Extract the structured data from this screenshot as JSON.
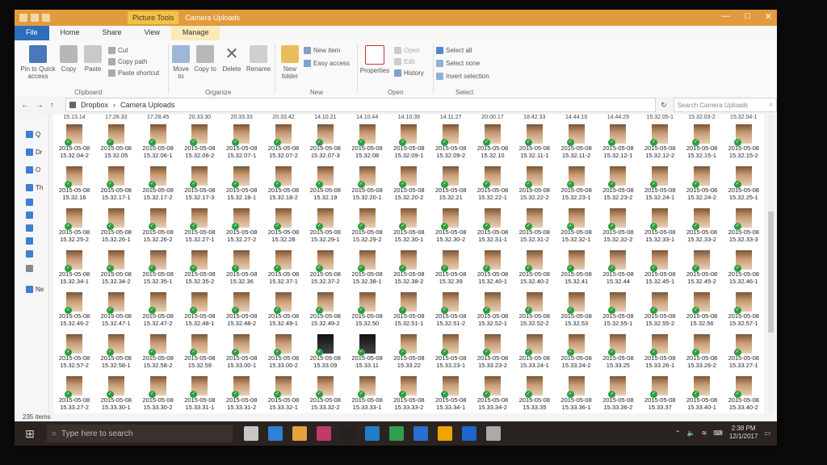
{
  "window": {
    "context_tab": "Picture Tools",
    "title": "Camera Uploads",
    "controls": [
      "—",
      "□",
      "✕"
    ]
  },
  "ribbon_tabs": [
    "File",
    "Home",
    "Share",
    "View",
    "Manage"
  ],
  "ribbon": {
    "pin_quick_access": "Pin to Quick access",
    "copy": "Copy",
    "paste": "Paste",
    "cut": "Cut",
    "copy_path": "Copy path",
    "paste_shortcut": "Paste shortcut",
    "move_to": "Move to",
    "copy_to": "Copy to",
    "delete": "Delete",
    "rename": "Rename",
    "new_folder": "New folder",
    "new_item": "New item",
    "easy_access": "Easy access",
    "properties": "Properties",
    "open": "Open",
    "edit": "Edit",
    "history": "History",
    "select_all": "Select all",
    "select_none": "Select none",
    "invert_selection": "Invert selection",
    "groups": {
      "clipboard": "Clipboard",
      "organize": "Organize",
      "new": "New",
      "open": "Open",
      "select": "Select"
    }
  },
  "address": {
    "path": [
      "Dropbox",
      "Camera Uploads"
    ],
    "search_placeholder": "Search Camera Uploads"
  },
  "nav_items": [
    "Q",
    "Dr",
    "O",
    "Th",
    "",
    "",
    "",
    "",
    "",
    "Ne"
  ],
  "top_times": [
    "15.13.14",
    "17.28.33",
    "17.28.45",
    "20.33.30",
    "20.33.33",
    "20.33.42",
    "14.10.21",
    "14.10.44",
    "14.10.39",
    "14.11.27",
    "20.00.17",
    "18.42.33",
    "14.44.10",
    "14.44.29",
    "15.32.05-1",
    "15.32.03-2",
    "15.32.04-1"
  ],
  "files": [
    [
      "2015-05-08 15.32.04-2",
      "2015-05-08 15.32.05",
      "2015-05-08 15.32.06-1",
      "2015-05-08 15.32.06-2",
      "2015-05-08 15.32.07-1",
      "2015-05-08 15.32.07-2",
      "2015-05-08 15.32.07-3",
      "2015-05-08 15.32.08",
      "2015-05-08 15.32.09-1",
      "2015-05-08 15.32.09-2",
      "2015-05-08 15.32.10",
      "2015-05-08 15.32.11-1",
      "2015-05-08 15.32.11-2",
      "2015-05-08 15.32.12-1",
      "2015-05-08 15.32.12-2",
      "2015-05-08 15.32.15-1",
      "2015-05-08 15.32.15-2"
    ],
    [
      "2015-05-08 15.32.16",
      "2015-05-08 15.32.17-1",
      "2015-05-08 15.32.17-2",
      "2015-05-08 15.32.17-3",
      "2015-05-08 15.32.18-1",
      "2015-05-08 15.32.18-2",
      "2015-05-08 15.32.19",
      "2015-05-08 15.32.20-1",
      "2015-05-08 15.32.20-2",
      "2015-05-08 15.32.21",
      "2015-05-08 15.32.22-1",
      "2015-05-08 15.32.22-2",
      "2015-05-08 15.32.23-1",
      "2015-05-08 15.32.23-2",
      "2015-05-08 15.32.24-1",
      "2015-05-08 15.32.24-2",
      "2015-05-08 15.32.25-1"
    ],
    [
      "2015-05-08 15.32.25-2",
      "2015-05-08 15.32.26-1",
      "2015-05-08 15.32.26-2",
      "2015-05-08 15.32.27-1",
      "2015-05-08 15.32.27-2",
      "2015-05-08 15.32.28",
      "2015-05-08 15.32.29-1",
      "2015-05-08 15.32.29-2",
      "2015-05-08 15.32.30-1",
      "2015-05-08 15.32.30-2",
      "2015-05-08 15.32.31-1",
      "2015-05-08 15.32.31-2",
      "2015-05-08 15.32.32-1",
      "2015-05-08 15.32.32-2",
      "2015-05-08 15.32.33-1",
      "2015-05-08 15.32.33-2",
      "2015-05-08 15.32.33-3"
    ],
    [
      "2015-05-08 15.32.34-1",
      "2015-05-08 15.32.34-2",
      "2015-05-08 15.32.35-1",
      "2015-05-08 15.32.35-2",
      "2015-05-08 15.32.36",
      "2015-05-08 15.32.37-1",
      "2015-05-08 15.32.37-2",
      "2015-05-08 15.32.38-1",
      "2015-05-08 15.32.38-2",
      "2015-05-08 15.32.39",
      "2015-05-08 15.32.40-1",
      "2015-05-08 15.32.40-2",
      "2015-05-08 15.32.41",
      "2015-05-08 15.32.44",
      "2015-05-08 15.32.45-1",
      "2015-05-08 15.32.45-2",
      "2015-05-08 15.32.46-1"
    ],
    [
      "2015-05-08 15.32.46-2",
      "2015-05-08 15.32.47-1",
      "2015-05-08 15.32.47-2",
      "2015-05-08 15.32.48-1",
      "2015-05-08 15.32.48-2",
      "2015-05-08 15.32.49-1",
      "2015-05-08 15.32.49-2",
      "2015-05-08 15.32.50",
      "2015-05-08 15.32.51-1",
      "2015-05-08 15.32.51-2",
      "2015-05-08 15.32.52-1",
      "2015-05-08 15.32.52-2",
      "2015-05-08 15.32.53",
      "2015-05-08 15.32.55-1",
      "2015-05-08 15.32.55-2",
      "2015-05-08 15.32.56",
      "2015-05-08 15.32.57-1"
    ],
    [
      "2015-05-08 15.32.57-2",
      "2015-05-08 15.32.58-1",
      "2015-05-08 15.32.58-2",
      "2015-05-08 15.32.59",
      "2015-05-08 15.33.00-1",
      "2015-05-08 15.33.00-2",
      "2015-05-08 15.33.09",
      "2015-05-08 15.33.11",
      "2015-05-08 15.33.22",
      "2015-05-08 15.33.23-1",
      "2015-05-08 15.33.23-2",
      "2015-05-08 15.33.24-1",
      "2015-05-08 15.33.24-2",
      "2015-05-08 15.33.25",
      "2015-05-08 15.33.26-1",
      "2015-05-08 15.33.26-2",
      "2015-05-08 15.33.27-1"
    ],
    [
      "2015-05-08 15.33.27-2",
      "2015-05-08 15.33.30-1",
      "2015-05-08 15.33.30-2",
      "2015-05-08 15.33.31-1",
      "2015-05-08 15.33.31-2",
      "2015-05-08 15.33.32-1",
      "2015-05-08 15.33.32-2",
      "2015-05-08 15.33.33-1",
      "2015-05-08 15.33.33-2",
      "2015-05-08 15.33.34-1",
      "2015-05-08 15.33.34-2",
      "2015-05-08 15.33.35",
      "2015-05-08 15.33.36-1",
      "2015-05-08 15.33.36-2",
      "2015-05-08 15.33.37",
      "2015-05-08 15.33.40-1",
      "2015-05-08 15.33.40-2"
    ]
  ],
  "dark_thumbs": [
    "5-6",
    "5-7"
  ],
  "status": {
    "item_count": "235 items"
  },
  "taskbar": {
    "search_placeholder": "Type here to search",
    "time": "2:38 PM",
    "date": "12/1/2017",
    "app_colors": [
      "#c7c7c7",
      "#2f80d8",
      "#e7a23c",
      "#c23a6a",
      "#222",
      "#1f7ec9",
      "#2f9e4f",
      "#2a6fd0",
      "#f0a400",
      "#1f66c9",
      "#aaaaaa"
    ]
  },
  "colors": {
    "accent": "#e39a3e",
    "file_tab": "#2b6fb8",
    "check": "#2e9e3f"
  }
}
